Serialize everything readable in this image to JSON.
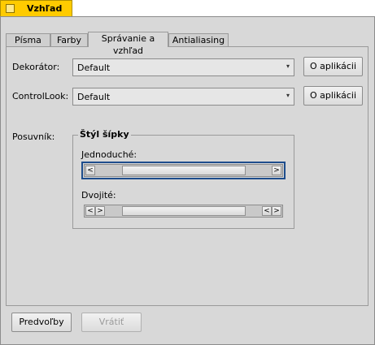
{
  "window": {
    "title": "Vzhľad"
  },
  "tabs": [
    {
      "label": "Písma"
    },
    {
      "label": "Farby"
    },
    {
      "label": "Správanie a vzhľad"
    },
    {
      "label": "Antialiasing"
    }
  ],
  "decorator": {
    "label": "Dekorátor:",
    "value": "Default",
    "about_label": "O aplikácii"
  },
  "controllook": {
    "label": "ControlLook:",
    "value": "Default",
    "about_label": "O aplikácii"
  },
  "scrollbar": {
    "label": "Posuvník:",
    "group_title": "Štýl šípky",
    "single_label": "Jednoduché:",
    "double_label": "Dvojité:"
  },
  "footer": {
    "defaults_label": "Predvoľby",
    "revert_label": "Vrátiť"
  }
}
